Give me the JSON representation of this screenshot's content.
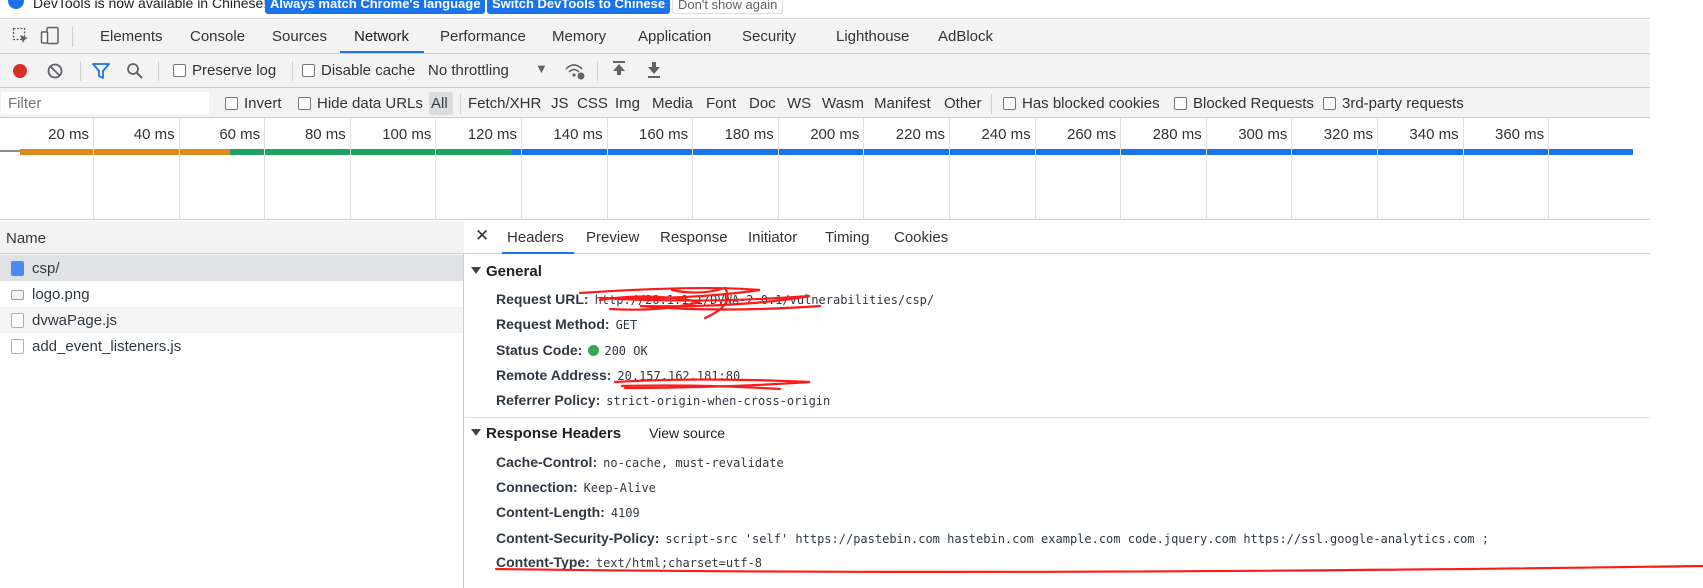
{
  "banner": {
    "text": "DevTools is now available in Chinese!",
    "btn_match": "Always match Chrome's language",
    "btn_switch": "Switch DevTools to Chinese",
    "btn_dismiss": "Don't show again"
  },
  "tabs": [
    "Elements",
    "Console",
    "Sources",
    "Network",
    "Performance",
    "Memory",
    "Application",
    "Security",
    "Lighthouse",
    "AdBlock"
  ],
  "toolbar": {
    "preserve_log": "Preserve log",
    "disable_cache": "Disable cache",
    "throttling": "No throttling"
  },
  "filter": {
    "placeholder": "Filter",
    "invert": "Invert",
    "hide_data_urls": "Hide data URLs",
    "types": [
      "All",
      "Fetch/XHR",
      "JS",
      "CSS",
      "Img",
      "Media",
      "Font",
      "Doc",
      "WS",
      "Wasm",
      "Manifest",
      "Other"
    ],
    "has_blocked_cookies": "Has blocked cookies",
    "blocked_requests": "Blocked Requests",
    "third_party": "3rd-party requests"
  },
  "timeline": {
    "ticks": [
      "20 ms",
      "40 ms",
      "60 ms",
      "80 ms",
      "100 ms",
      "120 ms",
      "140 ms",
      "160 ms",
      "180 ms",
      "200 ms",
      "220 ms",
      "240 ms",
      "260 ms",
      "280 ms",
      "300 ms",
      "320 ms",
      "340 ms",
      "360 ms"
    ],
    "colors": {
      "waiting": "#d98b1e",
      "download": "#1fa363",
      "total": "#1a73e8"
    }
  },
  "requests": {
    "header": "Name",
    "items": [
      {
        "name": "csp/",
        "type": "doc"
      },
      {
        "name": "logo.png",
        "type": "img"
      },
      {
        "name": "dvwaPage.js",
        "type": "script"
      },
      {
        "name": "add_event_listeners.js",
        "type": "script"
      }
    ]
  },
  "details": {
    "tabs": [
      "Headers",
      "Preview",
      "Response",
      "Initiator",
      "Timing",
      "Cookies"
    ],
    "general": {
      "title": "General",
      "request_url_label": "Request URL:",
      "request_url": "http://20.1.1.1/DVWA-2.0.1/vulnerabilities/csp/",
      "request_method_label": "Request Method:",
      "request_method": "GET",
      "status_code_label": "Status Code:",
      "status_code": "200 OK",
      "remote_address_label": "Remote Address:",
      "remote_address": "20.157.162.181:80",
      "referrer_policy_label": "Referrer Policy:",
      "referrer_policy": "strict-origin-when-cross-origin"
    },
    "response_headers": {
      "title": "Response Headers",
      "view_source": "View source",
      "rows": [
        {
          "k": "Cache-Control:",
          "v": "no-cache, must-revalidate"
        },
        {
          "k": "Connection:",
          "v": "Keep-Alive"
        },
        {
          "k": "Content-Length:",
          "v": "4109"
        },
        {
          "k": "Content-Security-Policy:",
          "v": "script-src 'self' https://pastebin.com hastebin.com example.com code.jquery.com https://ssl.google-analytics.com ;"
        },
        {
          "k": "Content-Type:",
          "v": "text/html;charset=utf-8"
        }
      ]
    }
  }
}
